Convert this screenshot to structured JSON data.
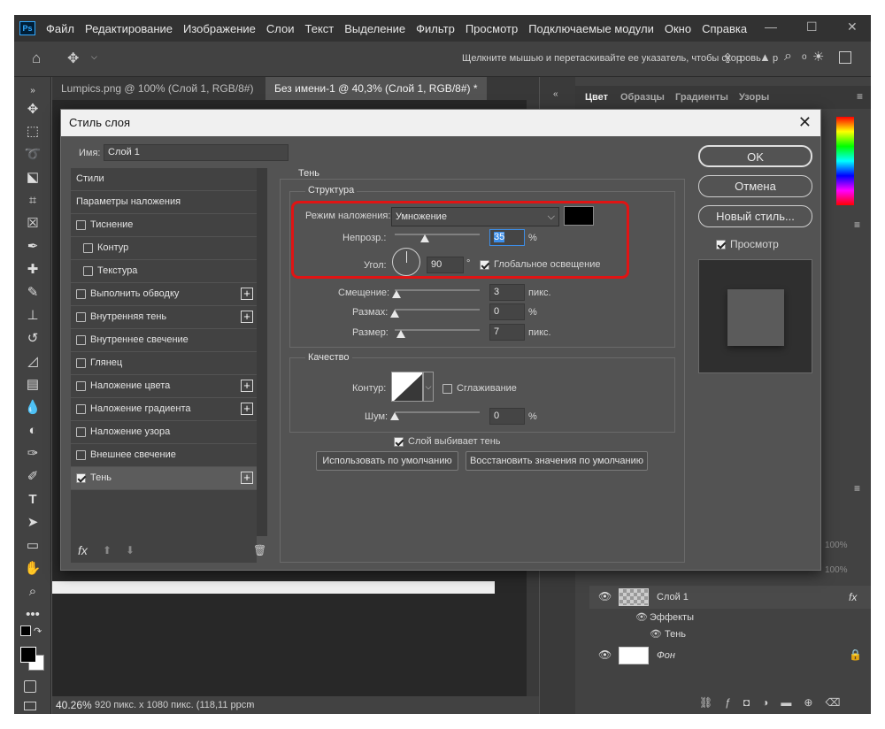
{
  "app": {
    "logo": "Ps",
    "menu": [
      "Файл",
      "Редактирование",
      "Изображение",
      "Слои",
      "Текст",
      "Выделение",
      "Фильтр",
      "Просмотр",
      "Подключаемые модули",
      "Окно",
      "Справка"
    ],
    "window_controls": [
      "—",
      "☐",
      "✕"
    ]
  },
  "options_bar": {
    "hint": "Щелкните мышью и перетаскивайте ее указатель, чтобы скор",
    "trail_1": "ровь",
    "trail_2": "р"
  },
  "doc_tabs": [
    {
      "label": "Lumpics.png @ 100% (Слой 1, RGB/8#)",
      "close": "✕"
    },
    {
      "label": "Без имени-1 @ 40,3% (Слой 1, RGB/8#) *",
      "close": "✕"
    }
  ],
  "status": {
    "zoom": "40.26%",
    "info": "920 пикс. x 1080 пикс. (118,11 ppcm"
  },
  "right_panel": {
    "tabs": [
      "Цвет",
      "Образцы",
      "Градиенты",
      "Узоры"
    ],
    "opacity_1": "100%",
    "opacity_2": "100%",
    "layers": [
      {
        "name": "Слой 1",
        "fx": "fx"
      },
      {
        "name": "Эффекты"
      },
      {
        "name": "Тень"
      },
      {
        "name": "Фон"
      }
    ]
  },
  "dialog": {
    "title": "Стиль слоя",
    "close": "✕",
    "name_label": "Имя:",
    "name_value": "Слой 1",
    "styles": [
      {
        "label": "Стили",
        "checkbox": false,
        "plus": false,
        "indent": false,
        "selected": false,
        "checked": false
      },
      {
        "label": "Параметры наложения",
        "checkbox": false,
        "plus": false,
        "indent": false,
        "selected": false,
        "checked": false
      },
      {
        "label": "Тиснение",
        "checkbox": true,
        "plus": false,
        "indent": false,
        "selected": false,
        "checked": false
      },
      {
        "label": "Контур",
        "checkbox": true,
        "plus": false,
        "indent": true,
        "selected": false,
        "checked": false
      },
      {
        "label": "Текстура",
        "checkbox": true,
        "plus": false,
        "indent": true,
        "selected": false,
        "checked": false
      },
      {
        "label": "Выполнить обводку",
        "checkbox": true,
        "plus": true,
        "indent": false,
        "selected": false,
        "checked": false
      },
      {
        "label": "Внутренняя тень",
        "checkbox": true,
        "plus": true,
        "indent": false,
        "selected": false,
        "checked": false
      },
      {
        "label": "Внутреннее свечение",
        "checkbox": true,
        "plus": false,
        "indent": false,
        "selected": false,
        "checked": false
      },
      {
        "label": "Глянец",
        "checkbox": true,
        "plus": false,
        "indent": false,
        "selected": false,
        "checked": false
      },
      {
        "label": "Наложение цвета",
        "checkbox": true,
        "plus": true,
        "indent": false,
        "selected": false,
        "checked": false
      },
      {
        "label": "Наложение градиента",
        "checkbox": true,
        "plus": true,
        "indent": false,
        "selected": false,
        "checked": false
      },
      {
        "label": "Наложение узора",
        "checkbox": true,
        "plus": false,
        "indent": false,
        "selected": false,
        "checked": false
      },
      {
        "label": "Внешнее свечение",
        "checkbox": true,
        "plus": false,
        "indent": false,
        "selected": false,
        "checked": false
      },
      {
        "label": "Тень",
        "checkbox": true,
        "plus": true,
        "indent": false,
        "selected": true,
        "checked": true
      }
    ],
    "list_footer": {
      "fx": "fx"
    },
    "section_title": "Тень",
    "structure": {
      "legend": "Структура",
      "blend_mode_label": "Режим наложения:",
      "blend_mode_value": "Умножение",
      "shadow_color": "#000000",
      "opacity_label": "Непрозр.:",
      "opacity_value": "35",
      "opacity_unit": "%",
      "opacity_fraction": 0.35,
      "angle_label": "Угол:",
      "angle_value": "90",
      "angle_unit": "°",
      "global_light_label": "Глобальное освещение",
      "global_light_checked": true,
      "distance_label": "Смещение:",
      "distance_value": "3",
      "distance_unit": "пикс.",
      "spread_label": "Размах:",
      "spread_value": "0",
      "spread_unit": "%",
      "size_label": "Размер:",
      "size_value": "7",
      "size_unit": "пикс."
    },
    "quality": {
      "legend": "Качество",
      "contour_label": "Контур:",
      "antialias_label": "Сглаживание",
      "noise_label": "Шум:",
      "noise_value": "0",
      "noise_unit": "%"
    },
    "knockout_label": "Слой выбивает тень",
    "default_button": "Использовать по умолчанию",
    "reset_button": "Восстановить значения по умолчанию",
    "ok_button": "OK",
    "cancel_button": "Отмена",
    "new_style_button": "Новый стиль...",
    "preview_label": "Просмотр",
    "highlight_color": "#e01414"
  }
}
